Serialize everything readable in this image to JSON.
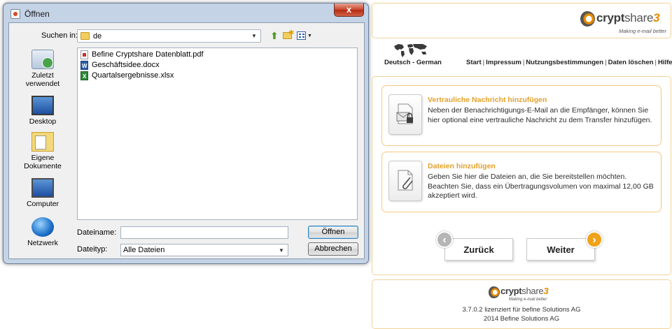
{
  "dialog": {
    "title": "Öffnen",
    "close_glyph": "x",
    "look_in_label": "Suchen in:",
    "look_in_value": "de",
    "places": [
      {
        "label": "Zuletzt verwendet",
        "icon": "recent-places-icon"
      },
      {
        "label": "Desktop",
        "icon": "desktop-icon"
      },
      {
        "label": "Eigene Dokumente",
        "icon": "documents-folder-icon"
      },
      {
        "label": "Computer",
        "icon": "computer-icon"
      },
      {
        "label": "Netzwerk",
        "icon": "network-icon"
      }
    ],
    "files": [
      {
        "name": "Befine Cryptshare Datenblatt.pdf",
        "type": "pdf"
      },
      {
        "name": "Geschäftsidee.docx",
        "type": "docx"
      },
      {
        "name": "Quartalsergebnisse.xlsx",
        "type": "xlsx"
      }
    ],
    "filename_label": "Dateiname:",
    "filename_value": "",
    "filetype_label": "Dateityp:",
    "filetype_value": "Alle Dateien",
    "open_button": "Öffnen",
    "cancel_button": "Abbrechen"
  },
  "cryptshare": {
    "logo": {
      "word1": "crypt",
      "word2": "share",
      "version_mark": "3",
      "tagline": "Making e-mail better"
    },
    "language": "Deutsch - German",
    "nav": [
      "Start",
      "Impressum",
      "Nutzungsbestimmungen",
      "Daten löschen",
      "Hilfe"
    ],
    "cards": [
      {
        "title": "Vertrauliche Nachricht hinzufügen",
        "text": "Neben der Benachrichtigungs-E-Mail an die Empfänger, können Sie hier optional eine vertrauliche Nachricht zu dem Transfer hinzufügen.",
        "icon": "mail-lock-icon"
      },
      {
        "title": "Dateien hinzufügen",
        "text": "Geben Sie hier die Dateien an, die Sie bereitstellen möchten. Beachten Sie, dass ein Übertragungsvolumen von maximal 12,00 GB akzeptiert wird.",
        "icon": "document-attachment-icon"
      }
    ],
    "back_button": "Zurück",
    "next_button": "Weiter",
    "footer_line1": "3.7.0.2 lizenziert für befine Solutions AG",
    "footer_line2": "2014 Befine Solutions AG"
  },
  "colors": {
    "accent_orange": "#e3a12a",
    "panel_border": "#efd39a",
    "dialog_frame": "#c4d3e6"
  }
}
